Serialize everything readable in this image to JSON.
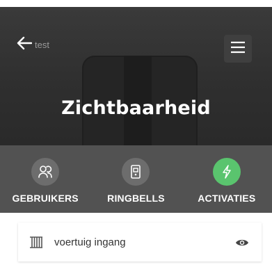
{
  "header": {
    "back_label": "test",
    "title": "Zichtbaarheid"
  },
  "tabs": [
    {
      "label": "GEBRUIKERS",
      "icon": "users-icon",
      "active": false
    },
    {
      "label": "RINGBELLS",
      "icon": "ringbell-icon",
      "active": false
    },
    {
      "label": "ACTIVATIES",
      "icon": "bolt-icon",
      "active": true
    }
  ],
  "items": [
    {
      "name": "voertuig ingang",
      "icon": "gate-icon",
      "visibility_icon": "eye-icon"
    }
  ],
  "colors": {
    "header_bg": "#2f2f2f",
    "tabs_bg": "#525252",
    "tab_circle": "#6d6d6d",
    "accent": "#5ac46e"
  }
}
